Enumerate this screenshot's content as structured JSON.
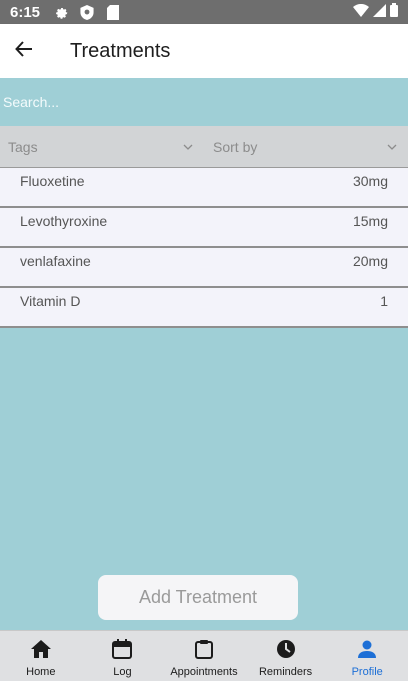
{
  "status_bar": {
    "time": "6:15"
  },
  "app_bar": {
    "title": "Treatments"
  },
  "search": {
    "placeholder": "Search..."
  },
  "filters": {
    "tags_label": "Tags",
    "sort_label": "Sort by"
  },
  "treatments": [
    {
      "name": "Fluoxetine",
      "dose": "30mg"
    },
    {
      "name": "Levothyroxine",
      "dose": "15mg"
    },
    {
      "name": "venlafaxine",
      "dose": "20mg"
    },
    {
      "name": "Vitamin D",
      "dose": "1"
    }
  ],
  "add_button": {
    "label": "Add Treatment"
  },
  "bottom_nav": {
    "items": [
      {
        "label": "Home",
        "icon": "home-icon"
      },
      {
        "label": "Log",
        "icon": "calendar-icon"
      },
      {
        "label": "Appointments",
        "icon": "clipboard-icon"
      },
      {
        "label": "Reminders",
        "icon": "clock-icon"
      },
      {
        "label": "Profile",
        "icon": "person-icon"
      }
    ],
    "active_index": 4
  },
  "colors": {
    "background": "#9fcfd6",
    "status_bar": "#6e6e6e",
    "list_item": "#f3f3fa",
    "filter_bar": "#d2d4d6",
    "nav_active": "#1d6fd6"
  }
}
